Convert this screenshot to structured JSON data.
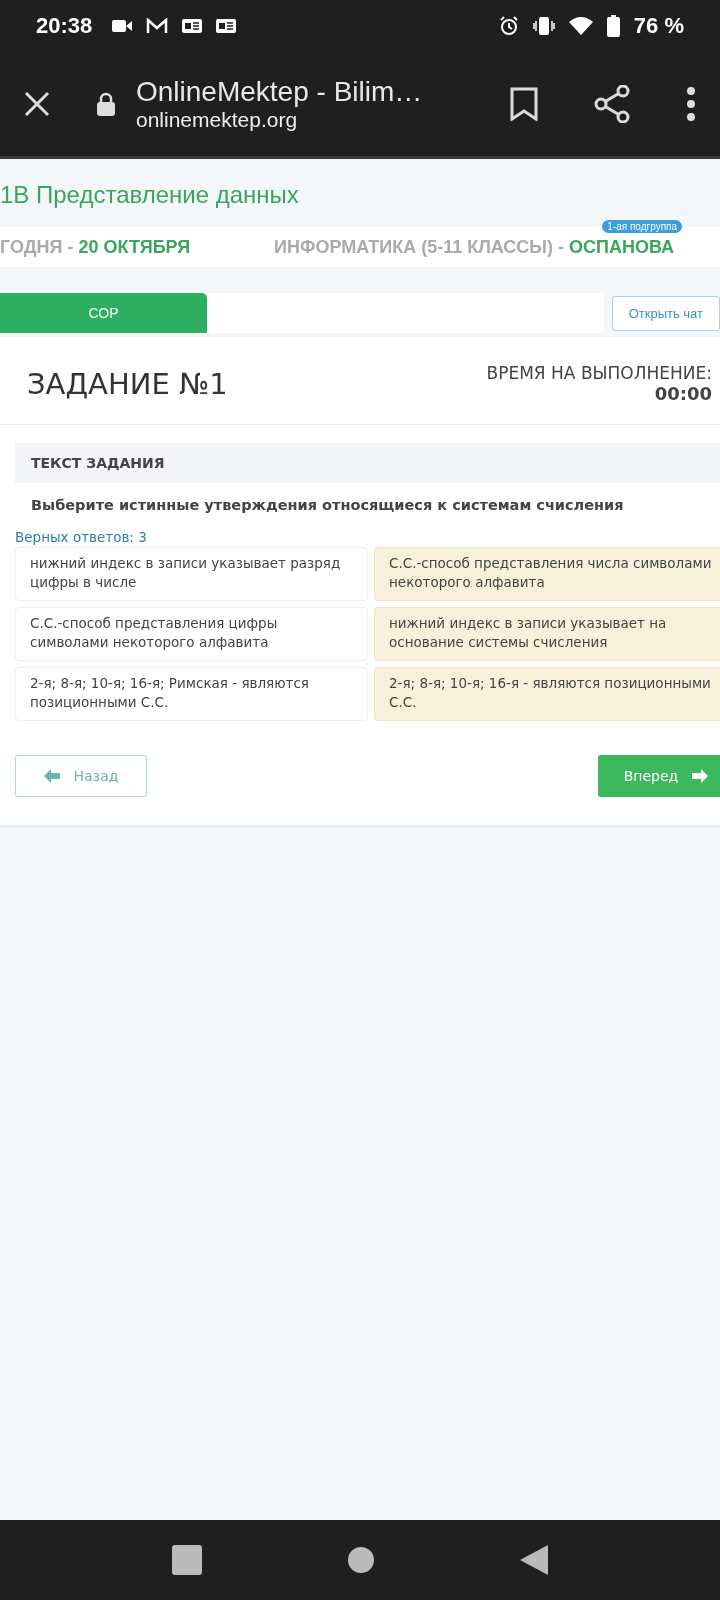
{
  "status_bar": {
    "time": "20:38",
    "battery": "76 %"
  },
  "browser": {
    "title": "OnlineMektep - Bilim…",
    "url": "onlinemektep.org"
  },
  "lesson": {
    "title": "1В Представление данных",
    "date_prefix": "ГОДНЯ - ",
    "date": "20 ОКТЯБРЯ",
    "subject": "ИНФОРМАТИКА (5-11 КЛАССЫ) - ",
    "teacher": "ОСПАНОВА",
    "badge": "1-ая подгруппа"
  },
  "tabs": [
    {
      "label": "СОР",
      "selected": true
    }
  ],
  "chat_button": "Открыть чат",
  "task": {
    "title": "ЗАДАНИЕ №1",
    "time_label": "ВРЕМЯ НА ВЫПОЛНЕНИЕ:",
    "time": "00:00",
    "section": "ТЕКСТ ЗАДАНИЯ",
    "question": "Выберите истинные утверждения относящиеся к системам счисления",
    "correct_count": "Верных ответов: 3"
  },
  "answers": [
    {
      "text": "нижний индекс в записи указывает разряд цифры в числе",
      "selected": false
    },
    {
      "text": "С.С.-способ представления числа символами некоторого алфавита",
      "selected": true
    },
    {
      "text": "С.С.-способ представления цифры символами некоторого алфавита",
      "selected": false
    },
    {
      "text": "нижний индекс в записи указывает на основание системы счисления",
      "selected": true
    },
    {
      "text": "2-я; 8-я; 10-я; 16-я; Римская - являются позиционными С.С.",
      "selected": false
    },
    {
      "text": "2-я; 8-я; 10-я; 16-я - являются позиционными С.С.",
      "selected": true
    }
  ],
  "back_button": "Назад",
  "next_button": "Вперед"
}
